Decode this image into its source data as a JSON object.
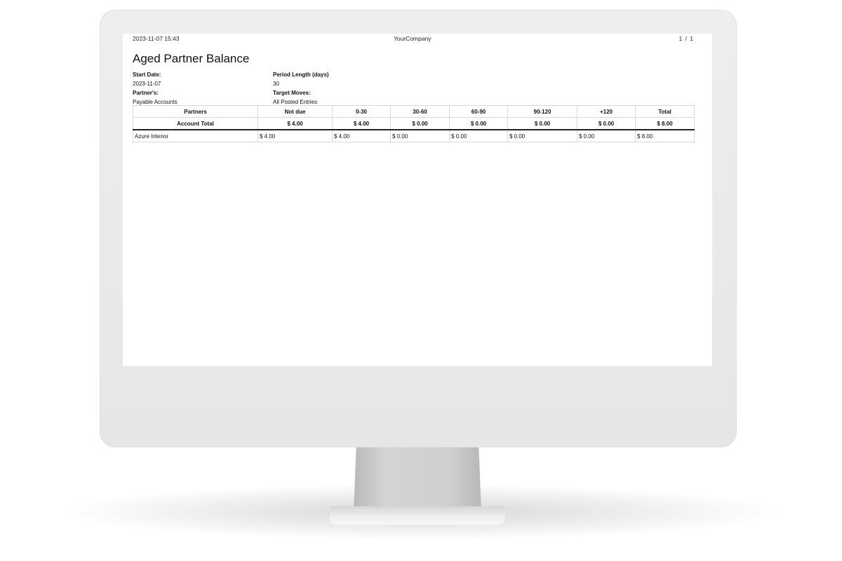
{
  "header": {
    "timestamp": "2023-11-07 15:43",
    "company": "YourCompany",
    "page": "1 / 1"
  },
  "report": {
    "title": "Aged Partner Balance",
    "start_date_label": "Start Date:",
    "start_date": "2023-11-07",
    "partners_label": "Partner's:",
    "partners": "Payable Accounts",
    "period_length_label": "Period Length (days)",
    "period_length": "30",
    "target_moves_label": "Target Moves:",
    "target_moves": "All Posted Entries"
  },
  "table": {
    "columns": [
      "Partners",
      "Not due",
      "0-30",
      "30-60",
      "60-90",
      "90-120",
      "+120",
      "Total"
    ],
    "account_total": [
      "Account Total",
      "$ 4.00",
      "$ 4.00",
      "$ 0.00",
      "$ 0.00",
      "$ 0.00",
      "$ 0.00",
      "$ 8.00"
    ],
    "rows": [
      [
        "Azure Interior",
        "$ 4.00",
        "$ 4.00",
        "$ 0.00",
        "$ 0.00",
        "$ 0.00",
        "$ 0.00",
        "$ 8.00"
      ]
    ]
  }
}
